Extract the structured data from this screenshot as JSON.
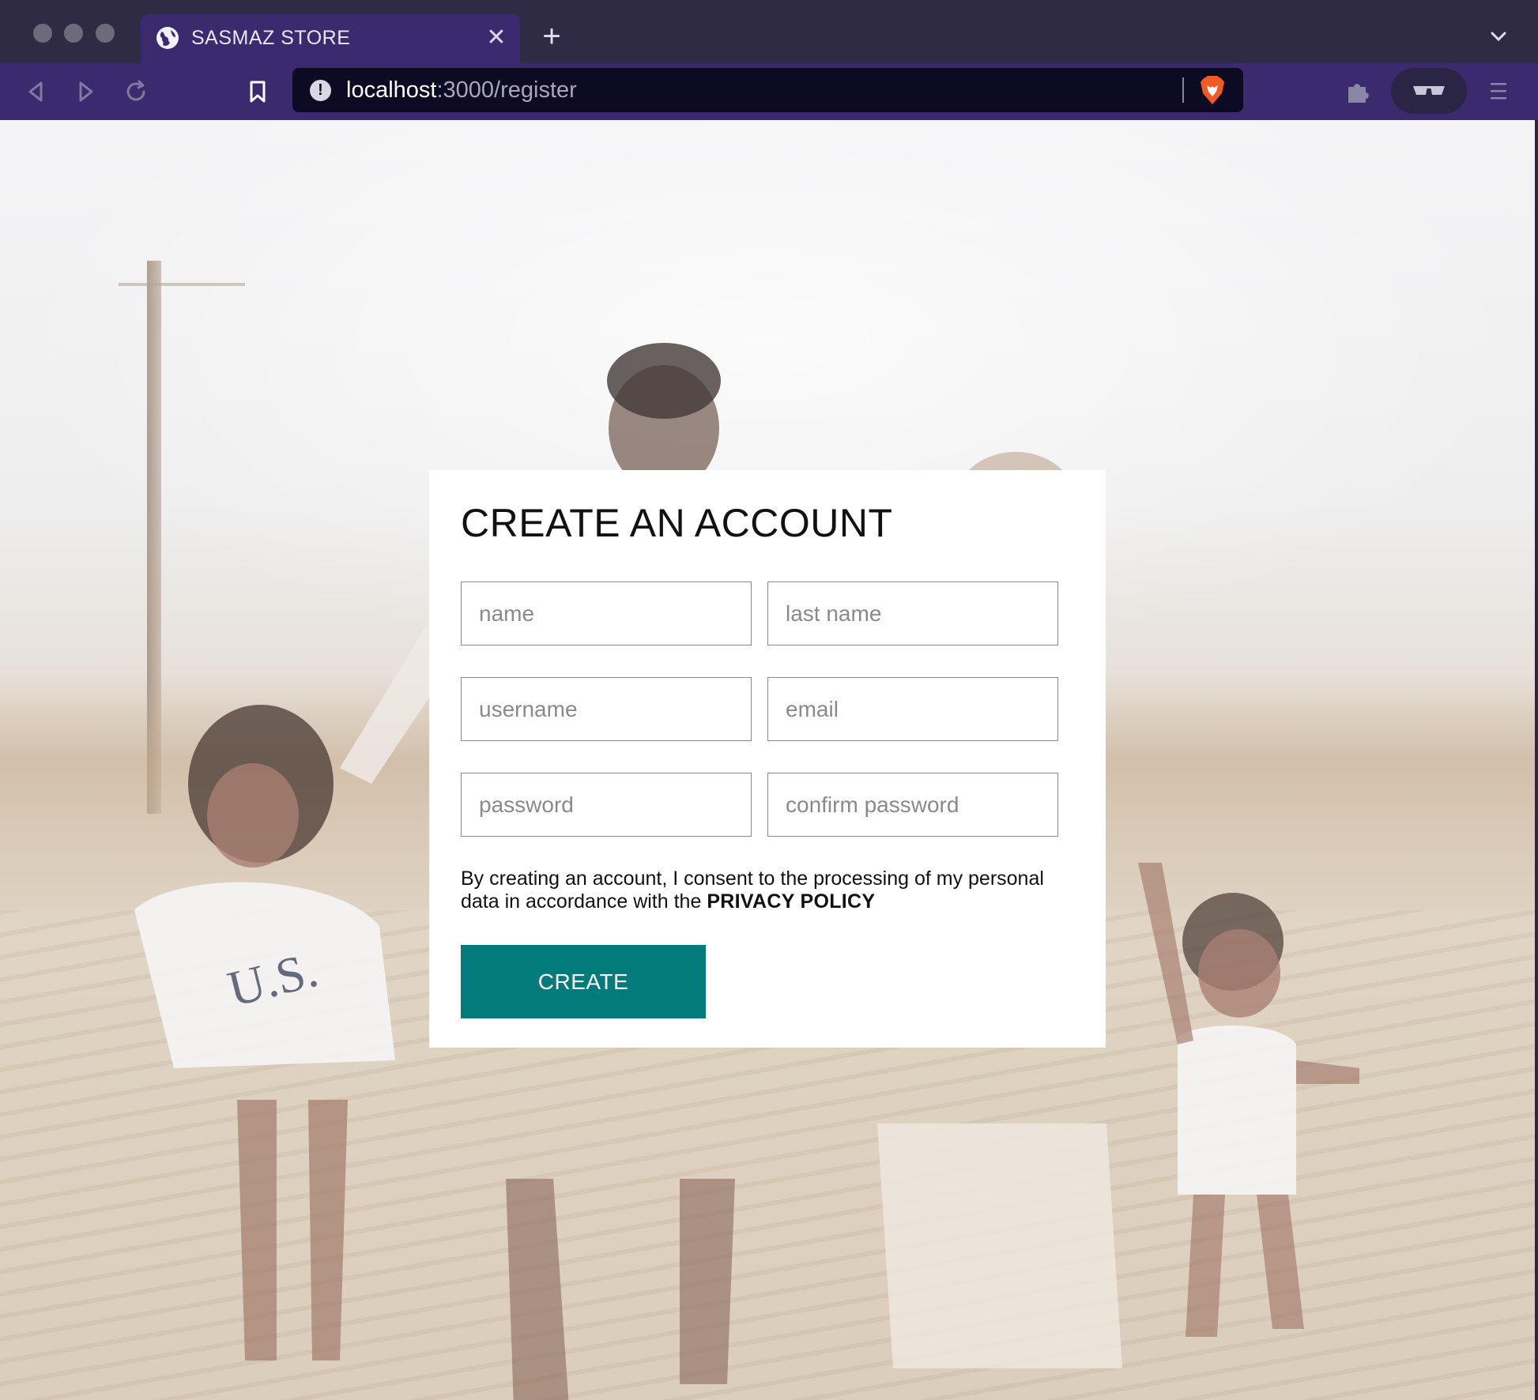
{
  "browser": {
    "tab": {
      "title": "SASMAZ STORE"
    },
    "url": {
      "host": "localhost",
      "path": ":3000/register"
    }
  },
  "form": {
    "title": "CREATE AN ACCOUNT",
    "fields": {
      "name": {
        "placeholder": "name"
      },
      "last_name": {
        "placeholder": "last name"
      },
      "username": {
        "placeholder": "username"
      },
      "email": {
        "placeholder": "email"
      },
      "password": {
        "placeholder": "password"
      },
      "confirm_password": {
        "placeholder": "confirm password"
      }
    },
    "consent_text": "By creating an account, I consent to the processing of my personal data in accordance with the ",
    "privacy_link": "PRIVACY POLICY",
    "submit_label": "CREATE"
  },
  "colors": {
    "accent": "#047b7b",
    "chrome_bg": "#3b2a6e",
    "urlbar_bg": "#0d0a24"
  },
  "icons": [
    "globe-icon",
    "close-icon",
    "plus-icon",
    "chevron-down-icon",
    "back-icon",
    "forward-icon",
    "reload-icon",
    "bookmark-icon",
    "info-icon",
    "brave-lion-icon",
    "puzzle-icon",
    "sunglasses-icon",
    "menu-icon"
  ]
}
